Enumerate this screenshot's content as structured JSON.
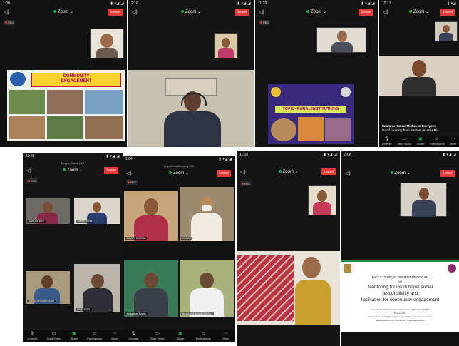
{
  "common": {
    "zoom_label": "Zoom",
    "leave_label": "Leave",
    "rec_label": "REC"
  },
  "screens": {
    "s1": {
      "time": "1:00",
      "slide_title": "COMMUNITY ENGAGEMENT"
    },
    "s2": {
      "time": "2:16"
    },
    "s3": {
      "time": "11:29",
      "slide_topic": "TOPIC- RURAL INSTITUTIONS"
    },
    "s4": {
      "time": "10:17",
      "chat_sender": "Santanu Kumar Mishra to Everyone",
      "chat_message": "Good morning from Santanu Kumar Mis",
      "toolbar": [
        "Unmute",
        "Start Video",
        "Share",
        "Participants",
        "More"
      ]
    },
    "s5": {
      "time": "10:23",
      "host": "Deepa Jhanshi Wi",
      "tiles": [
        "SANDYA DEY",
        "Tushar Mehta",
        "Santanu Kumar Mishra",
        "DILIP PATIL"
      ],
      "toolbar": [
        "Unmute",
        "Start Video",
        "Share",
        "Participants",
        "More"
      ]
    },
    "s6": {
      "time": "1:04",
      "host": "Priyabrata Mohanty Wifi",
      "tiles": [
        "SAVITA MISHRA",
        "CLAWS",
        "Bhagaban Padhy",
        "BHABANANDA BEHERA..."
      ],
      "toolbar": [
        "Unmute",
        "Start Video",
        "Share",
        "Participants",
        "More"
      ]
    },
    "s7": {
      "time": "11:10"
    },
    "s8": {
      "time": "3:08",
      "slide_lines": [
        "FACULTY DEVELOPMENT PROGRAM",
        "on",
        "Mentoring for institutional social",
        "responsibility and",
        "facilitation for community engagement"
      ],
      "slide_footer": [
        "MAHARSHI DEGREE COLLEGE, Keduk, DIST: KENDUJHAR",
        "Powered by:",
        "Santanu Kumar Pradhan, Chittaranjan Pradhan, Sangitarani Debata,",
        "Mallik Maria, Binduri Moharolo, Tryambagam Sahu"
      ]
    }
  },
  "colors": {
    "leave": "#e53935",
    "zoom_dot": "#2ea44f",
    "background": "#141414",
    "slide_banner": "#f8d12d"
  }
}
